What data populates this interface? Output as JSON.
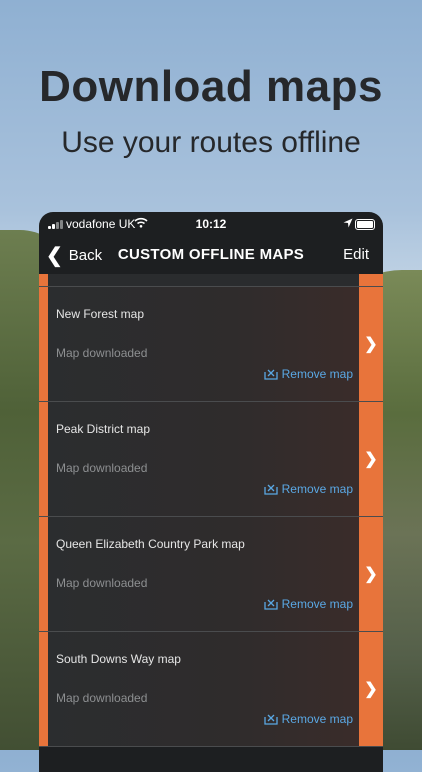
{
  "promo": {
    "headline": "Download maps",
    "subline": "Use your routes offline"
  },
  "status_bar": {
    "carrier": "vodafone UK",
    "time": "10:12"
  },
  "nav": {
    "back_label": "Back",
    "title": "CUSTOM OFFLINE MAPS",
    "edit_label": "Edit"
  },
  "maps": [
    {
      "name": "New Forest map",
      "status": "Map downloaded",
      "remove_label": "Remove map"
    },
    {
      "name": "Peak District map",
      "status": "Map downloaded",
      "remove_label": "Remove map"
    },
    {
      "name": "Queen Elizabeth Country Park map",
      "status": "Map downloaded",
      "remove_label": "Remove map"
    },
    {
      "name": "South Downs Way map",
      "status": "Map downloaded",
      "remove_label": "Remove map"
    }
  ],
  "colors": {
    "accent": "#e8743b",
    "link": "#5aa8e4",
    "panel": "#1d1f21"
  }
}
